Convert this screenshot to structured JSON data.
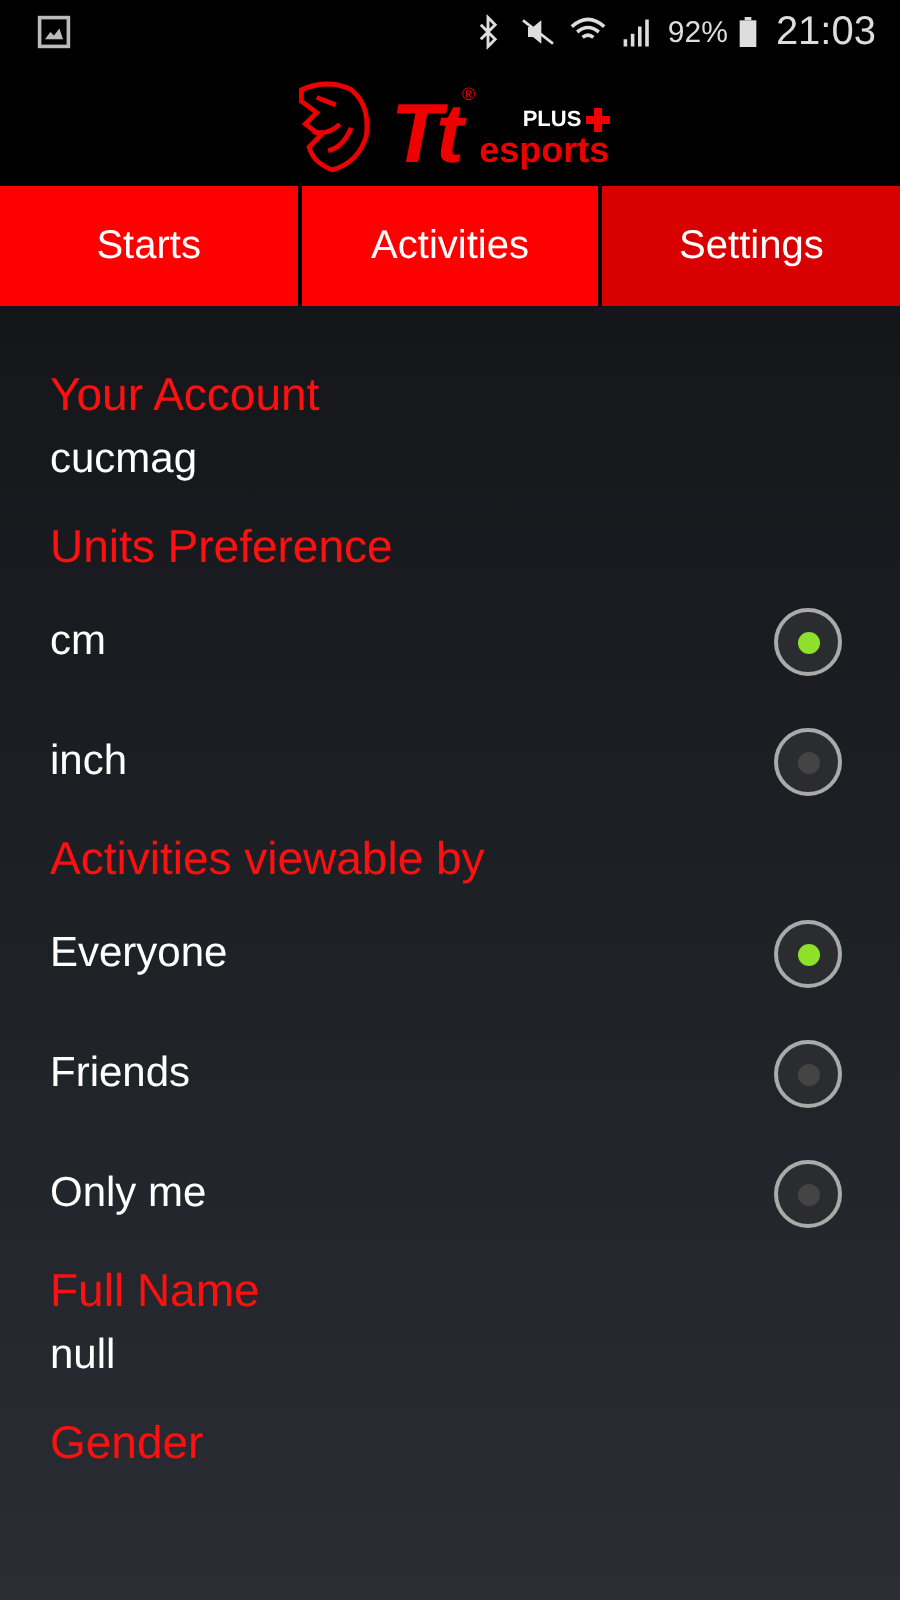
{
  "status_bar": {
    "battery": "92%",
    "time": "21:03"
  },
  "logo": {
    "mark": "Tt",
    "registered": "®",
    "plus": "PLUS",
    "brand": "esports"
  },
  "tabs": [
    {
      "label": "Starts",
      "selected": false
    },
    {
      "label": "Activities",
      "selected": false
    },
    {
      "label": "Settings",
      "selected": true
    }
  ],
  "sections": [
    {
      "kind": "value",
      "heading": "Your Account",
      "value": "cucmag"
    },
    {
      "kind": "radio",
      "heading": "Units Preference",
      "options": [
        {
          "label": "cm",
          "selected": true
        },
        {
          "label": "inch",
          "selected": false
        }
      ]
    },
    {
      "kind": "radio",
      "heading": "Activities viewable by",
      "options": [
        {
          "label": "Everyone",
          "selected": true
        },
        {
          "label": "Friends",
          "selected": false
        },
        {
          "label": "Only me",
          "selected": false
        }
      ]
    },
    {
      "kind": "value",
      "heading": "Full Name",
      "value": "null"
    },
    {
      "kind": "value",
      "heading": "Gender"
    }
  ]
}
